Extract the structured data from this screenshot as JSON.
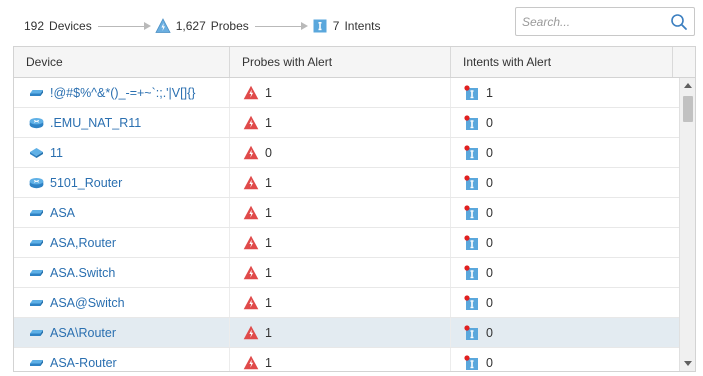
{
  "summary": {
    "devices_count": "192",
    "devices_label": "Devices",
    "probes_count": "1,627",
    "probes_label": "Probes",
    "intents_count": "7",
    "intents_label": "Intents"
  },
  "search": {
    "placeholder": "Search...",
    "value": ""
  },
  "table": {
    "columns": [
      "Device",
      "Probes with Alert",
      "Intents with Alert"
    ],
    "rows": [
      {
        "device": "!@#$%^&*()_-=+~`:;.'|V[]{}",
        "device_icon": "switch-icon",
        "probes": "1",
        "intents": "1",
        "selected": false
      },
      {
        "device": ".EMU_NAT_R11",
        "device_icon": "router-icon",
        "probes": "1",
        "intents": "0",
        "selected": false
      },
      {
        "device": "11",
        "device_icon": "firewall-icon",
        "probes": "0",
        "intents": "0",
        "selected": false
      },
      {
        "device": "5101_Router",
        "device_icon": "router-icon",
        "probes": "1",
        "intents": "0",
        "selected": false
      },
      {
        "device": "ASA",
        "device_icon": "switch-icon",
        "probes": "1",
        "intents": "0",
        "selected": false
      },
      {
        "device": "ASA,Router",
        "device_icon": "switch-icon",
        "probes": "1",
        "intents": "0",
        "selected": false
      },
      {
        "device": "ASA.Switch",
        "device_icon": "switch-icon",
        "probes": "1",
        "intents": "0",
        "selected": false
      },
      {
        "device": "ASA@Switch",
        "device_icon": "switch-icon",
        "probes": "1",
        "intents": "0",
        "selected": false
      },
      {
        "device": "ASA\\Router",
        "device_icon": "switch-icon",
        "probes": "1",
        "intents": "0",
        "selected": true
      },
      {
        "device": "ASA-Router",
        "device_icon": "switch-icon",
        "probes": "1",
        "intents": "0",
        "selected": false
      }
    ]
  },
  "colors": {
    "link": "#2a6fb0",
    "alert_red": "#e04a4a",
    "intent_blue": "#5aa7dc",
    "selected_row": "#e3ebf1"
  }
}
